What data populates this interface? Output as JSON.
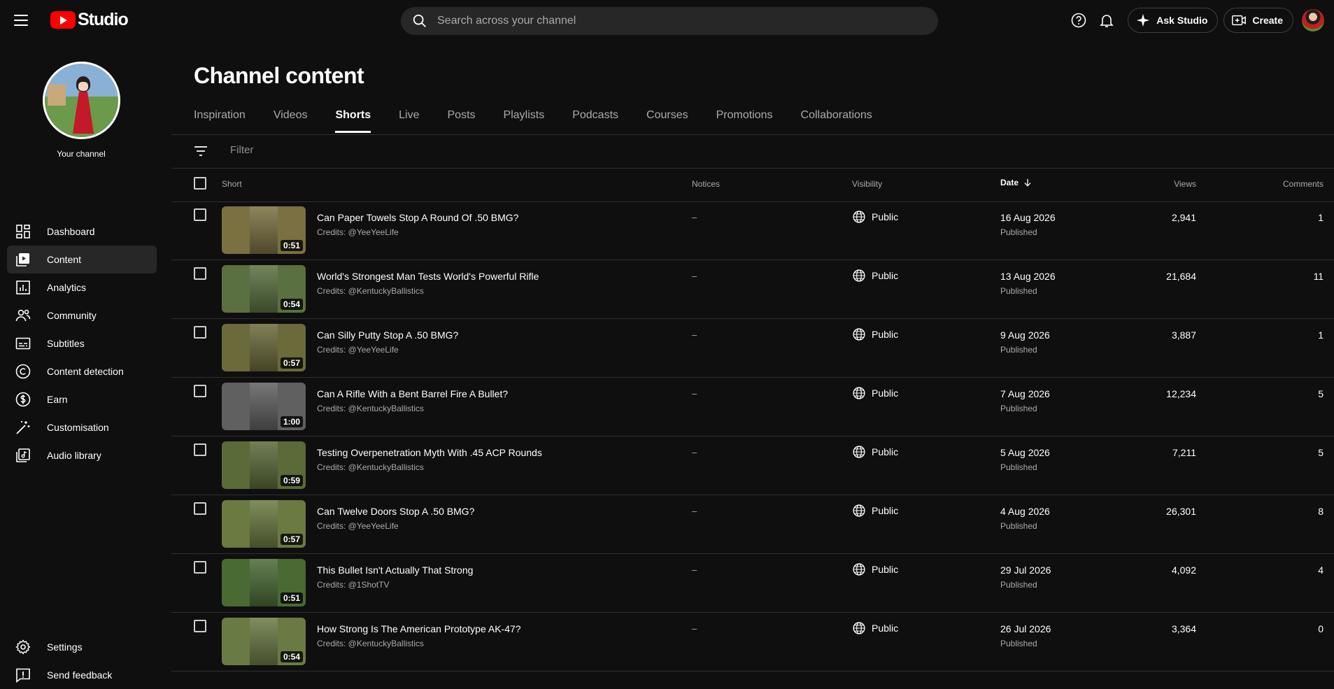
{
  "app": {
    "logo_text": "Studio",
    "brand_color": "#ff0000"
  },
  "search": {
    "placeholder": "Search across your channel"
  },
  "topbar": {
    "ask_studio_label": "Ask Studio",
    "create_label": "Create"
  },
  "sidebar": {
    "channel_label": "Your channel",
    "items": [
      {
        "label": "Dashboard",
        "icon": "dashboard-icon",
        "active": false
      },
      {
        "label": "Content",
        "icon": "content-icon",
        "active": true
      },
      {
        "label": "Analytics",
        "icon": "analytics-icon",
        "active": false
      },
      {
        "label": "Community",
        "icon": "community-icon",
        "active": false
      },
      {
        "label": "Subtitles",
        "icon": "subtitles-icon",
        "active": false
      },
      {
        "label": "Content detection",
        "icon": "copyright-icon",
        "active": false
      },
      {
        "label": "Earn",
        "icon": "dollar-icon",
        "active": false
      },
      {
        "label": "Customisation",
        "icon": "magic-wand-icon",
        "active": false
      },
      {
        "label": "Audio library",
        "icon": "audio-library-icon",
        "active": false
      }
    ],
    "bottom_items": [
      {
        "label": "Settings",
        "icon": "gear-icon"
      },
      {
        "label": "Send feedback",
        "icon": "feedback-icon"
      }
    ]
  },
  "main": {
    "title": "Channel content",
    "tabs": [
      {
        "label": "Inspiration"
      },
      {
        "label": "Videos"
      },
      {
        "label": "Shorts"
      },
      {
        "label": "Live"
      },
      {
        "label": "Posts"
      },
      {
        "label": "Playlists"
      },
      {
        "label": "Podcasts"
      },
      {
        "label": "Courses"
      },
      {
        "label": "Promotions"
      },
      {
        "label": "Collaborations"
      }
    ],
    "active_tab": "Shorts",
    "filter": {
      "placeholder": "Filter"
    },
    "columns": {
      "short": "Short",
      "notices": "Notices",
      "visibility": "Visibility",
      "date": "Date",
      "views": "Views",
      "comments": "Comments"
    },
    "rows": [
      {
        "title": "Can Paper Towels Stop A Round Of .50 BMG?",
        "credits": "Credits: @YeeYeeLife",
        "duration": "0:51",
        "notices": "–",
        "visibility": "Public",
        "date": "16 Aug 2026",
        "status": "Published",
        "views": "2,941",
        "comments": "1",
        "thumb_color": "#7a7040"
      },
      {
        "title": "World's Strongest Man Tests World's Powerful Rifle",
        "credits": "Credits: @KentuckyBallistics",
        "duration": "0:54",
        "notices": "–",
        "visibility": "Public",
        "date": "13 Aug 2026",
        "status": "Published",
        "views": "21,684",
        "comments": "11",
        "thumb_color": "#5a7040"
      },
      {
        "title": "Can Silly Putty Stop A .50 BMG?",
        "credits": "Credits: @YeeYeeLife",
        "duration": "0:57",
        "notices": "–",
        "visibility": "Public",
        "date": "9 Aug 2026",
        "status": "Published",
        "views": "3,887",
        "comments": "1",
        "thumb_color": "#6a6a3a"
      },
      {
        "title": "Can A Rifle With a Bent Barrel Fire A Bullet?",
        "credits": "Credits: @KentuckyBallistics",
        "duration": "1:00",
        "notices": "–",
        "visibility": "Public",
        "date": "7 Aug 2026",
        "status": "Published",
        "views": "12,234",
        "comments": "5",
        "thumb_color": "#606060"
      },
      {
        "title": "Testing Overpenetration Myth With .45 ACP Rounds",
        "credits": "Credits: @KentuckyBallistics",
        "duration": "0:59",
        "notices": "–",
        "visibility": "Public",
        "date": "5 Aug 2026",
        "status": "Published",
        "views": "7,211",
        "comments": "5",
        "thumb_color": "#5a6a38"
      },
      {
        "title": "Can Twelve Doors Stop A .50 BMG?",
        "credits": "Credits: @YeeYeeLife",
        "duration": "0:57",
        "notices": "–",
        "visibility": "Public",
        "date": "4 Aug 2026",
        "status": "Published",
        "views": "26,301",
        "comments": "8",
        "thumb_color": "#6a7a40"
      },
      {
        "title": "This Bullet Isn't Actually That Strong",
        "credits": "Credits: @1ShotTV",
        "duration": "0:51",
        "notices": "–",
        "visibility": "Public",
        "date": "29 Jul 2026",
        "status": "Published",
        "views": "4,092",
        "comments": "4",
        "thumb_color": "#4a6a34"
      },
      {
        "title": "How Strong Is The American Prototype AK-47?",
        "credits": "Credits: @KentuckyBallistics",
        "duration": "0:54",
        "notices": "–",
        "visibility": "Public",
        "date": "26 Jul 2026",
        "status": "Published",
        "views": "3,364",
        "comments": "0",
        "thumb_color": "#6a7a44"
      }
    ]
  }
}
